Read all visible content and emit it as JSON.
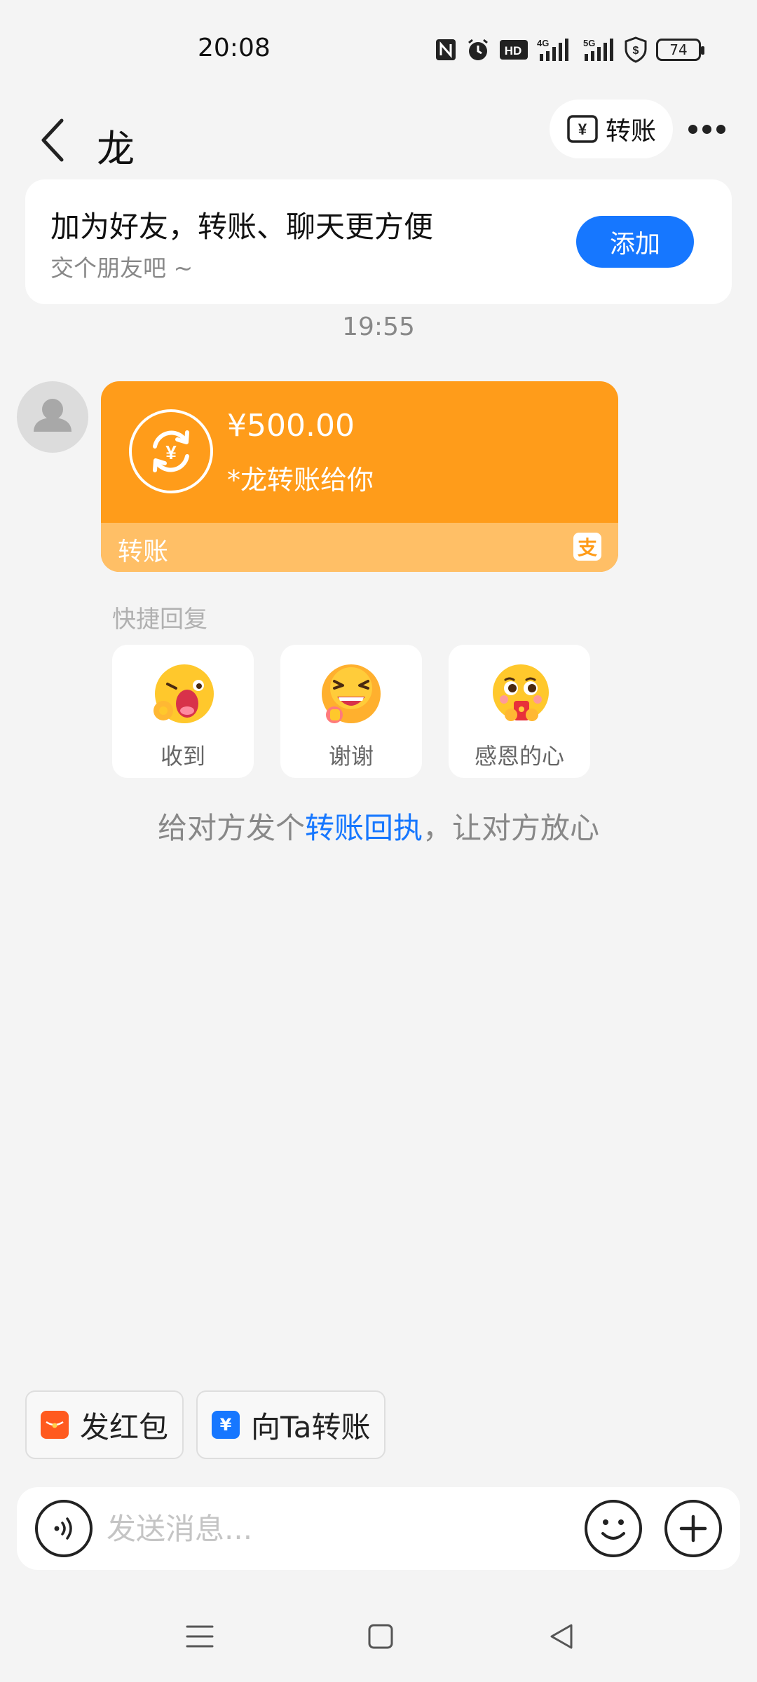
{
  "status_bar": {
    "time": "20:08",
    "network_4g": "4G",
    "network_5g": "5G",
    "hd_badge": "HD",
    "battery": "74"
  },
  "header": {
    "contact_name": "龙",
    "transfer_chip_label": "转账",
    "transfer_chip_symbol": "¥"
  },
  "friend_card": {
    "title": "加为好友，转账、聊天更方便",
    "subtitle": "交个朋友吧 ~",
    "add_button": "添加"
  },
  "chat": {
    "timestamp": "19:55",
    "transfer_message": {
      "amount": "¥500.00",
      "description": "*龙转账给你",
      "footer_label": "转账",
      "icon_symbol": "¥",
      "logo_symbol": "支"
    }
  },
  "quick_reply": {
    "title": "快捷回复",
    "items": [
      {
        "label": "收到"
      },
      {
        "label": "谢谢"
      },
      {
        "label": "感恩的心"
      }
    ]
  },
  "receipt_tip": {
    "prefix": "给对方发个",
    "link": "转账回执",
    "suffix": "，让对方放心"
  },
  "shortcuts": {
    "red_packet": "发红包",
    "transfer": "向Ta转账",
    "transfer_symbol": "¥"
  },
  "input_bar": {
    "placeholder": "发送消息..."
  },
  "colors": {
    "accent_blue": "#1677ff",
    "transfer_orange": "#ff9c1a",
    "transfer_footer": "#ffbf66",
    "red_packet": "#ff5a1f"
  },
  "icons": {
    "status": [
      "nfc-icon",
      "alarm-icon",
      "hd-icon",
      "signal-4g-icon",
      "signal-5g-icon",
      "shield-dollar-icon",
      "battery-icon"
    ],
    "nav": [
      "menu-icon",
      "home-icon",
      "back-triangle-icon"
    ]
  }
}
